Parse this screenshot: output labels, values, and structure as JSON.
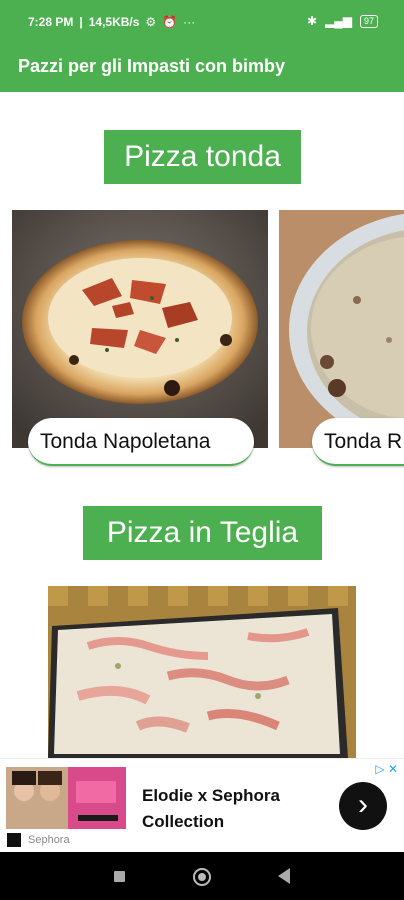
{
  "status_bar": {
    "time": "7:28 PM",
    "net_speed": "14,5KB/s",
    "battery": "97",
    "left_icons": [
      "alarm-icon",
      "clock-icon",
      "more-icon"
    ],
    "right_icons": [
      "bluetooth-icon",
      "signal-icon",
      "battery-icon"
    ]
  },
  "app_bar": {
    "title": "Pazzi per gli Impasti con bimby"
  },
  "sections": [
    {
      "header": "Pizza tonda",
      "cards": [
        {
          "label": "Tonda Napoletana",
          "image": "pizza-napoletana-photo"
        },
        {
          "label": "Tonda Romana",
          "visible_label": "Tonda R",
          "image": "pizza-romana-photo"
        }
      ]
    },
    {
      "header": "Pizza in Teglia",
      "cards": [
        {
          "label": "",
          "image": "pizza-teglia-photo"
        }
      ]
    }
  ],
  "ad": {
    "title": "Elodie x Sephora Collection",
    "source": "Sephora",
    "cta_icon": "chevron-right-icon",
    "choices_icon": "adchoices-icon"
  },
  "nav_bar": {
    "icons": [
      "recents-icon",
      "home-icon",
      "back-icon"
    ]
  },
  "colors": {
    "primary": "#4caf50",
    "nav_background": "#000000"
  }
}
